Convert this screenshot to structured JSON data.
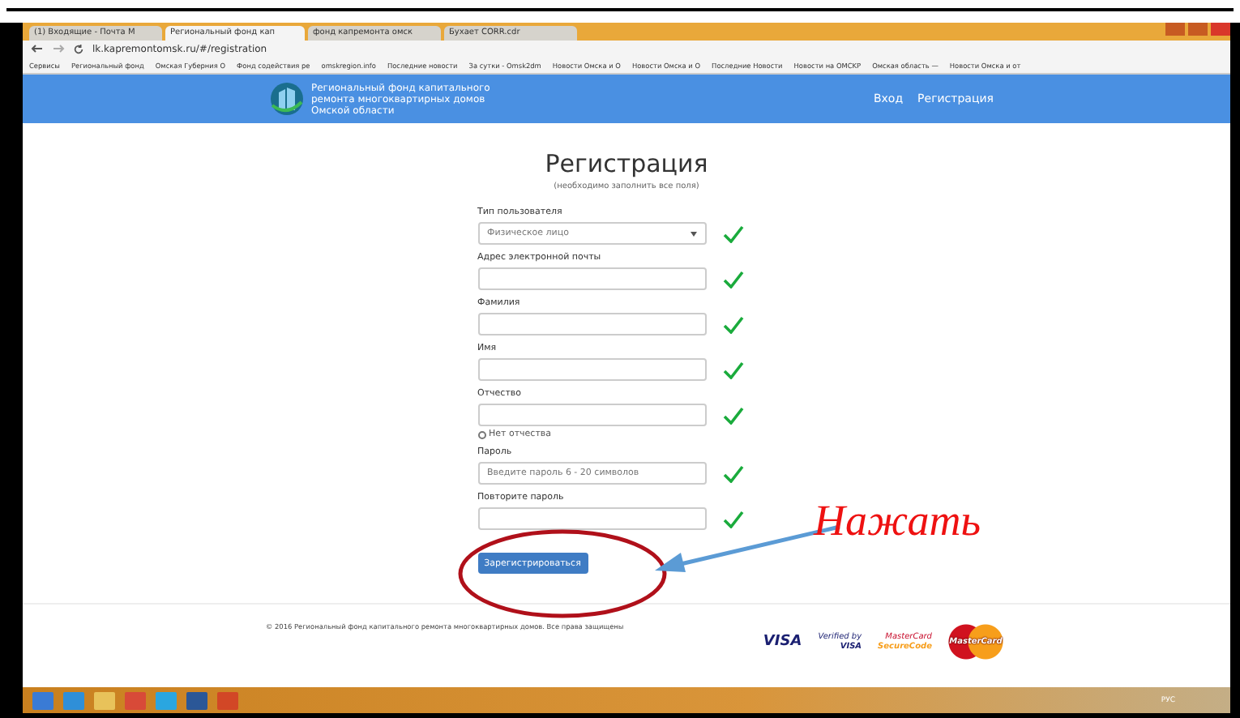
{
  "browser": {
    "tabs": [
      {
        "title": "(1) Входящие - Почта М",
        "selected": false
      },
      {
        "title": "Региональный фонд кап",
        "selected": true
      },
      {
        "title": "фонд капремонта омск",
        "selected": false
      },
      {
        "title": "Бухает CORR.cdr",
        "selected": false
      }
    ],
    "address": "lk.kapremontomsk.ru/#/registration",
    "bookmarks": [
      "Сервисы",
      "Региональный фонд",
      "Омская Губерния О",
      "Фонд содействия ре",
      "omskregion.info",
      "Последние новости",
      "За сутки - Omsk2dm",
      "Новости Омска и О",
      "Новости Омска и О",
      "Последние Новости",
      "Новости на OMCKP",
      "Омская область —",
      "Новости Омска и от"
    ]
  },
  "header": {
    "org_lines": [
      "Региональный фонд капитального",
      "ремонта многоквартирных домов",
      "Омской области"
    ],
    "nav": [
      "Вход",
      "Регистрация"
    ]
  },
  "form": {
    "title": "Регистрация",
    "subtitle": "(необходимо заполнить все поля)",
    "fields": [
      {
        "kind": "select",
        "label": "Тип пользователя",
        "value": "Физическое лицо",
        "valid": true
      },
      {
        "kind": "input",
        "label": "Адрес электронной почты",
        "valid": true
      },
      {
        "kind": "input",
        "label": "Фамилия",
        "valid": true
      },
      {
        "kind": "input",
        "label": "Имя",
        "valid": true
      },
      {
        "kind": "input",
        "label": "Отчество",
        "valid": true
      },
      {
        "kind": "checkbox",
        "label": "Нет отчества",
        "checked": false
      },
      {
        "kind": "input",
        "label": "Пароль",
        "placeholder": "Введите пароль 6 - 20 символов",
        "valid": true
      },
      {
        "kind": "input",
        "label": "Повторите пароль",
        "valid": true
      }
    ],
    "submit": "Зарегистрироваться"
  },
  "annotation": {
    "text": "Нажать"
  },
  "footer": {
    "copyright": "© 2016 Региональный фонд капитального ремонта многоквартирных домов. Все права защищены",
    "cards": [
      {
        "kind": "visa",
        "text": "VISA"
      },
      {
        "kind": "verified",
        "lines": [
          "Verified by",
          "VISA"
        ]
      },
      {
        "kind": "securecode",
        "lines": [
          "MasterCard",
          "SecureCode"
        ]
      },
      {
        "kind": "mastercard",
        "text": "MasterCard"
      }
    ]
  },
  "taskbar": {
    "language": "РУС"
  }
}
